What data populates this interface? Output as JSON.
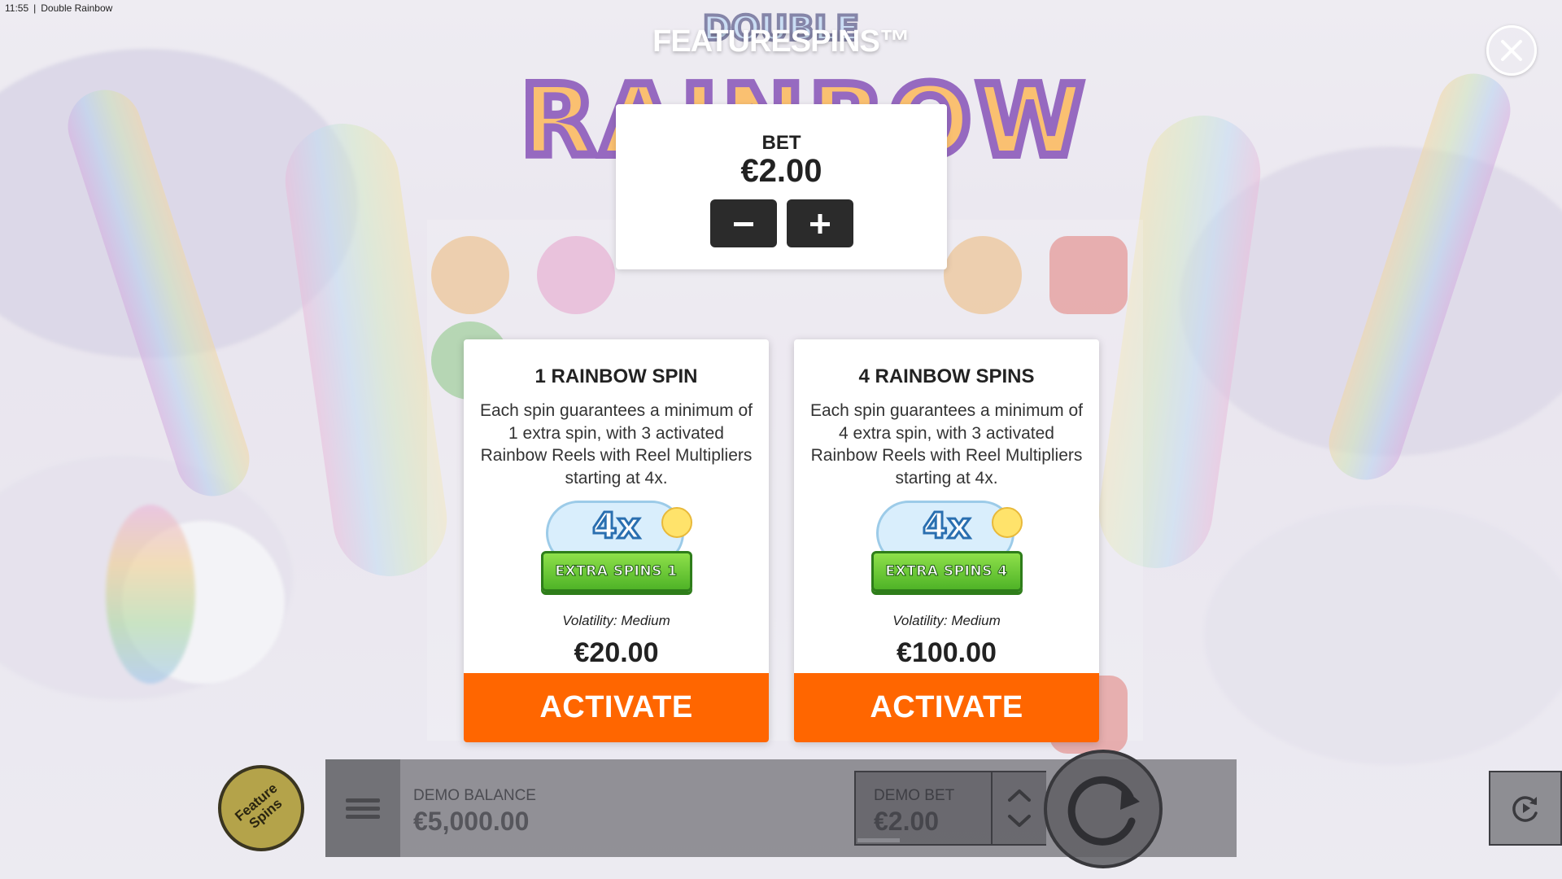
{
  "status_bar": {
    "time": "11:55",
    "separator": "|",
    "app_name": "Double Rainbow"
  },
  "logo": {
    "top_text": "DOUBLE",
    "main_text": "RAINBOW"
  },
  "modal": {
    "title": "FEATURESPINS™",
    "close_icon": "close-icon",
    "bet": {
      "label": "BET",
      "value": "€2.00",
      "decrease_icon": "minus-icon",
      "increase_icon": "plus-icon"
    },
    "cards": [
      {
        "title": "1 RAINBOW SPIN",
        "description": "Each spin guarantees a minimum of 1 extra spin, with 3 activated Rainbow Reels with Reel Multipliers starting at 4x.",
        "badge_multiplier": "4x",
        "badge_text": "EXTRA SPINS 1",
        "volatility": "Volatility: Medium",
        "price": "€20.00",
        "button": "ACTIVATE"
      },
      {
        "title": "4 RAINBOW SPINS",
        "description": "Each spin guarantees a minimum of 4 extra spin, with 3 activated Rainbow Reels with Reel Multipliers starting at 4x.",
        "badge_multiplier": "4x",
        "badge_text": "EXTRA SPINS 4",
        "volatility": "Volatility: Medium",
        "price": "€100.00",
        "button": "ACTIVATE"
      }
    ]
  },
  "bottom_bar": {
    "feature_spins_button": "Feature Spins",
    "menu_icon": "hamburger-menu-icon",
    "balance_label": "DEMO BALANCE",
    "balance_value": "€5,000.00",
    "bet_label": "DEMO BET",
    "bet_value": "€2.00",
    "bet_up_icon": "chevron-up-icon",
    "bet_down_icon": "chevron-down-icon",
    "spin_icon": "spin-arrow-icon",
    "autoplay_icon": "autoplay-icon"
  },
  "colors": {
    "activate": "#ff6600",
    "bet_buttons": "#2b2b2b",
    "card_bg": "#ffffff",
    "badge_green": "#4fb327",
    "feature_circle": "#b4a34a"
  }
}
